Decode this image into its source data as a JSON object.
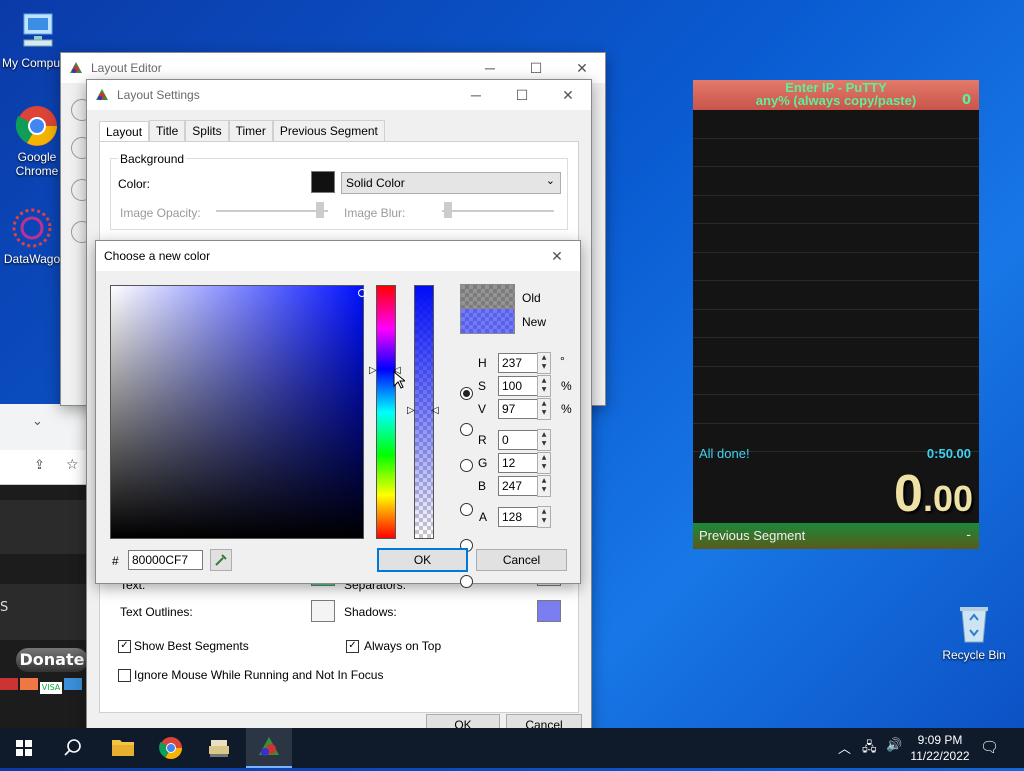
{
  "desktop": {
    "icons": [
      {
        "label": "My Compu",
        "icon": "computer-icon"
      },
      {
        "label": "Google Chrome",
        "icon": "chrome-icon"
      },
      {
        "label": "DataWago",
        "icon": "datawagon-icon"
      },
      {
        "label": "Recycle Bin",
        "icon": "recycle-bin-icon"
      }
    ]
  },
  "layout_editor": {
    "title": "Layout Editor"
  },
  "layout_settings": {
    "title": "Layout Settings",
    "tabs": [
      "Layout",
      "Title",
      "Splits",
      "Timer",
      "Previous Segment"
    ],
    "background_group": "Background",
    "color_label": "Color:",
    "color_type": "Solid Color",
    "image_opacity_label": "Image Opacity:",
    "image_blur_label": "Image Blur:",
    "text_label": "Text:",
    "separators_label": "Separators:",
    "text_outlines_label": "Text Outlines:",
    "shadows_label": "Shadows:",
    "show_best_segments": "Show Best Segments",
    "always_on_top": "Always on Top",
    "ignore_mouse": "Ignore Mouse While Running and Not In Focus",
    "ok": "OK",
    "cancel": "Cancel",
    "colors": {
      "background": "#111111",
      "text": "#3ce08a",
      "separators": "#f4f4f4",
      "text_outlines": "#f4f4f4",
      "shadows": "#7b7ef0"
    }
  },
  "color_dialog": {
    "title": "Choose a new color",
    "old_label": "Old",
    "new_label": "New",
    "h_label": "H",
    "h_value": "237",
    "h_unit": "°",
    "s_label": "S",
    "s_value": "100",
    "s_unit": "%",
    "v_label": "V",
    "v_value": "97",
    "v_unit": "%",
    "r_label": "R",
    "r_value": "0",
    "g_label": "G",
    "g_value": "12",
    "b_label": "B",
    "b_value": "247",
    "a_label": "A",
    "a_value": "128",
    "hex_prefix": "#",
    "hex_value": "80000CF7",
    "ok": "OK",
    "cancel": "Cancel",
    "selected_mode": "H",
    "new_color": "#000cf7"
  },
  "livesplit": {
    "title_line1": "Enter IP - PuTTY",
    "title_line2": "any% (always copy/paste)",
    "attempts": "0",
    "status": "All done!",
    "status_time": "0:50.00",
    "timer_main": "0",
    "timer_dec": ".00",
    "prev_segment_label": "Previous Segment",
    "prev_segment_value": "-"
  },
  "browser_partial": {
    "donate": "Donate",
    "letter": "S"
  },
  "taskbar": {
    "time": "9:09 PM",
    "date": "11/22/2022"
  }
}
